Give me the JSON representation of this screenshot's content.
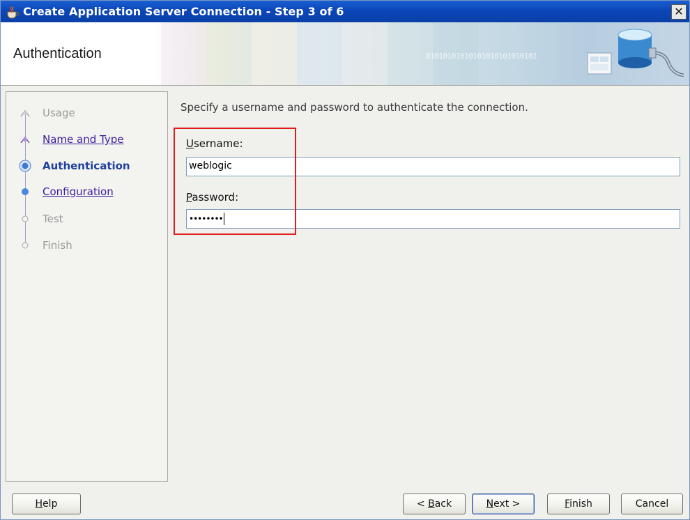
{
  "window": {
    "title": "Create Application Server Connection - Step 3 of 6",
    "close_glyph": "✕"
  },
  "banner": {
    "title": "Authentication",
    "binary_text": "01010101010101010101010101"
  },
  "nav": {
    "items": [
      {
        "label": "Usage",
        "state": "disabled"
      },
      {
        "label": "Name and Type",
        "state": "visited"
      },
      {
        "label": "Authentication",
        "state": "current"
      },
      {
        "label": "Configuration",
        "state": "link"
      },
      {
        "label": "Test",
        "state": "disabled"
      },
      {
        "label": "Finish",
        "state": "disabled"
      }
    ]
  },
  "form": {
    "instructions": "Specify a username and password to authenticate the connection.",
    "username": {
      "label_first": "U",
      "label_rest": "sername:",
      "value": "weblogic"
    },
    "password": {
      "label_first": "P",
      "label_rest": "assword:",
      "value": "••••••••"
    }
  },
  "buttons": {
    "help": {
      "mnemonic": "H",
      "rest": "elp"
    },
    "back": {
      "prefix": "< ",
      "mnemonic": "B",
      "rest": "ack"
    },
    "next": {
      "mnemonic": "N",
      "rest": "ext >"
    },
    "finish": {
      "mnemonic": "F",
      "rest": "inish"
    },
    "cancel": {
      "label": "Cancel"
    }
  },
  "colors": {
    "titlebar": "#0b46b8",
    "highlight_box": "#e11b1b",
    "link": "#3a1d9e",
    "current_step": "#1e3f9e"
  }
}
